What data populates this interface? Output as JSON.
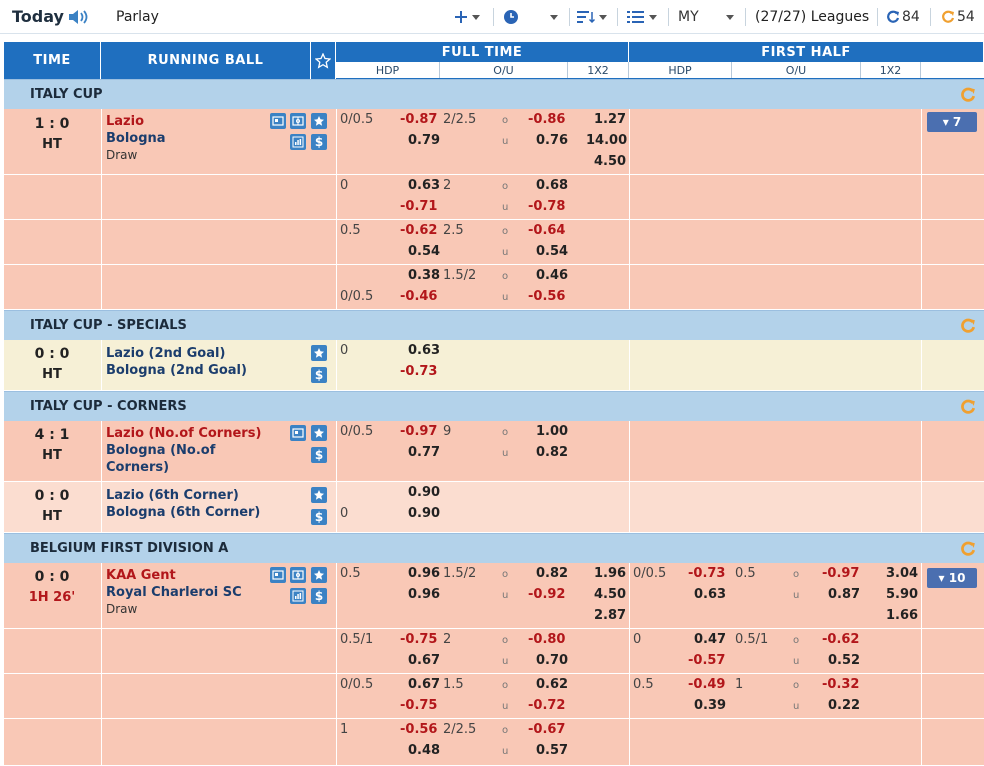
{
  "topbar": {
    "today": "Today",
    "parlay": "Parlay",
    "lang": "MY",
    "leagues": "(27/27) Leagues",
    "refresh_a": "84",
    "refresh_b": "54"
  },
  "header": {
    "time": "TIME",
    "running_ball": "RUNNING BALL",
    "full_time": "FULL TIME",
    "first_half": "FIRST HALF",
    "hdp": "HDP",
    "ou": "O/U",
    "x12": "1X2"
  },
  "leagues": {
    "italy_cup": "ITALY CUP",
    "italy_cup_specials": "ITALY CUP - SPECIALS",
    "italy_cup_corners": "ITALY CUP - CORNERS",
    "belgium": "BELGIUM FIRST DIVISION A"
  },
  "m1": {
    "score": "1 : 0",
    "status": "HT",
    "home": "Lazio",
    "away": "Bologna",
    "draw": "Draw",
    "more": "▾ 7",
    "r1": {
      "hdp": "0/0.5",
      "h": "-0.87",
      "a": "0.79",
      "ou": "2/2.5",
      "o": "-0.86",
      "u": "0.76",
      "x1": "1.27",
      "x2": "14.00",
      "xx": "4.50"
    },
    "r2": {
      "hdp": "0",
      "h": "0.63",
      "a": "-0.71",
      "ou": "2",
      "o": "0.68",
      "u": "-0.78"
    },
    "r3": {
      "hdp": "0.5",
      "h": "-0.62",
      "a": "0.54",
      "ou": "2.5",
      "o": "-0.64",
      "u": "0.54"
    },
    "r4": {
      "hdp": "0/0.5",
      "h": "0.38",
      "a": "-0.46",
      "ou": "1.5/2",
      "o": "0.46",
      "u": "-0.56"
    }
  },
  "m2": {
    "score": "0 : 0",
    "status": "HT",
    "home": "Lazio (2nd Goal)",
    "away": "Bologna (2nd Goal)",
    "r1": {
      "hdp": "0",
      "h": "0.63",
      "a": "-0.73"
    }
  },
  "m3": {
    "score": "4 : 1",
    "status": "HT",
    "home": "Lazio (No.of Corners)",
    "away_1": "Bologna (No.of",
    "away_2": "Corners)",
    "r1": {
      "hdp": "0/0.5",
      "h": "-0.97",
      "a": "0.77",
      "ou": "9",
      "o": "1.00",
      "u": "0.82"
    }
  },
  "m4": {
    "score": "0 : 0",
    "status": "HT",
    "home": "Lazio (6th Corner)",
    "away": "Bologna (6th Corner)",
    "r1": {
      "hdp": "0",
      "h": "0.90",
      "a": "0.90"
    }
  },
  "m5": {
    "score": "0 : 0",
    "status": "1H 26'",
    "home": "KAA Gent",
    "away": "Royal Charleroi SC",
    "draw": "Draw",
    "more": "▾ 10",
    "r1": {
      "hdp": "0.5",
      "h": "0.96",
      "a": "0.96",
      "ou": "1.5/2",
      "o": "0.82",
      "u": "-0.92",
      "x1": "1.96",
      "x2": "4.50",
      "xx": "2.87",
      "fh_hdp": "0/0.5",
      "fh_h": "-0.73",
      "fh_a": "0.63",
      "fh_ou": "0.5",
      "fh_o": "-0.97",
      "fh_u": "0.87",
      "fh_x1": "3.04",
      "fh_x2": "5.90",
      "fh_xx": "1.66"
    },
    "r2": {
      "hdp": "0.5/1",
      "h": "-0.75",
      "a": "0.67",
      "ou": "2",
      "o": "-0.80",
      "u": "0.70",
      "fh_hdp": "0",
      "fh_h": "0.47",
      "fh_a": "-0.57",
      "fh_ou": "0.5/1",
      "fh_o": "-0.62",
      "fh_u": "0.52"
    },
    "r3": {
      "hdp": "0/0.5",
      "h": "0.67",
      "a": "-0.75",
      "ou": "1.5",
      "o": "0.62",
      "u": "-0.72",
      "fh_hdp": "0.5",
      "fh_h": "-0.49",
      "fh_a": "0.39",
      "fh_ou": "1",
      "fh_o": "-0.32",
      "fh_u": "0.22"
    },
    "r4": {
      "hdp": "1",
      "h": "-0.56",
      "a": "0.48",
      "ou": "2/2.5",
      "o": "-0.67",
      "u": "0.57"
    }
  },
  "labels": {
    "o": "o",
    "u": "u"
  },
  "colors": {
    "header_blue": "#1f6fbf",
    "league_bar": "#b3d2ea",
    "row_pink": "#f9c8b6",
    "row_light": "#fbddd0",
    "row_yellow": "#f6f0d6",
    "negative": "#b2161a",
    "team_blue": "#1b3d6d",
    "accent_orange": "#f0a030"
  }
}
